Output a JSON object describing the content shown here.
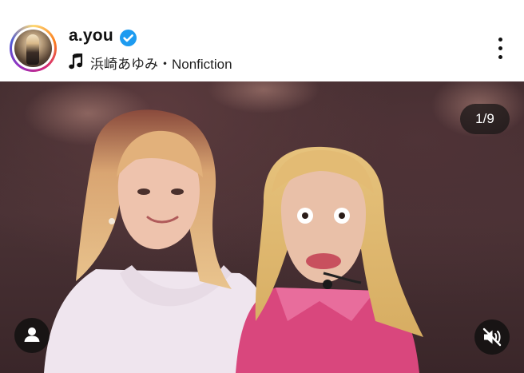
{
  "post_header": {
    "username": "a.you",
    "verified": true,
    "audio_label": "浜崎あゆみ・Nonfiction"
  },
  "carousel": {
    "position_text": "1/9",
    "current": 1,
    "total": 9
  },
  "icons": {
    "avatar": "profile-avatar",
    "verified": "verified-badge-icon",
    "audio": "music-note-icon",
    "more": "more-options-icon",
    "tag": "person-tag-icon",
    "mute": "speaker-muted-icon"
  },
  "colors": {
    "verified": "#1d9bf0",
    "overlay": "#141212",
    "story_ring": [
      "#feda75",
      "#fa7e1e",
      "#d62976",
      "#962fbf",
      "#4f5bd5"
    ]
  }
}
